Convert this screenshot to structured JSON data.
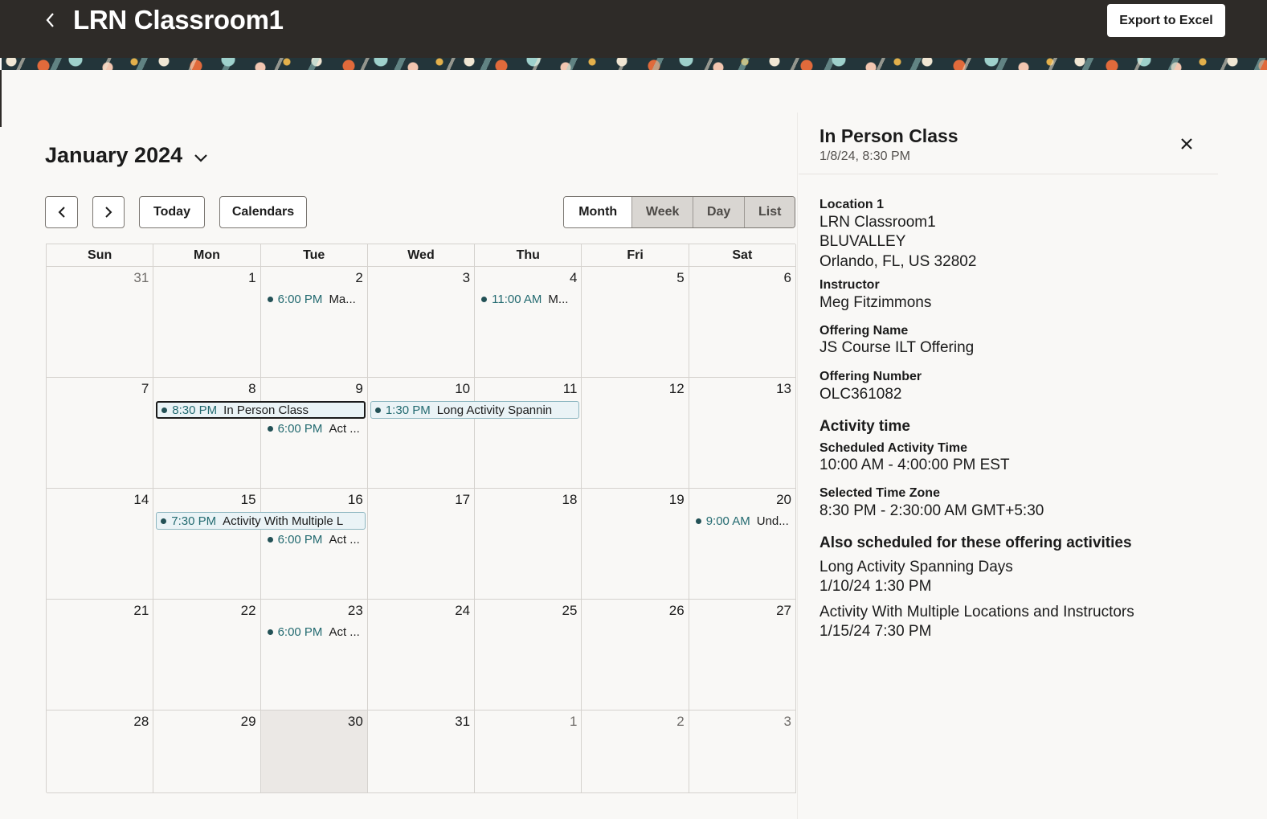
{
  "header": {
    "title": "LRN Classroom1",
    "export_label": "Export to Excel"
  },
  "toolbar": {
    "month_label": "January 2024",
    "today_label": "Today",
    "calendars_label": "Calendars",
    "views": [
      "Month",
      "Week",
      "Day",
      "List"
    ],
    "selected_view": "Month"
  },
  "calendar": {
    "days_of_week": [
      "Sun",
      "Mon",
      "Tue",
      "Wed",
      "Thu",
      "Fri",
      "Sat"
    ],
    "weeks": [
      [
        {
          "d": "31",
          "muted": true
        },
        {
          "d": "1"
        },
        {
          "d": "2"
        },
        {
          "d": "3"
        },
        {
          "d": "4"
        },
        {
          "d": "5"
        },
        {
          "d": "6"
        }
      ],
      [
        {
          "d": "7"
        },
        {
          "d": "8"
        },
        {
          "d": "9"
        },
        {
          "d": "10"
        },
        {
          "d": "11"
        },
        {
          "d": "12"
        },
        {
          "d": "13"
        }
      ],
      [
        {
          "d": "14"
        },
        {
          "d": "15"
        },
        {
          "d": "16"
        },
        {
          "d": "17"
        },
        {
          "d": "18"
        },
        {
          "d": "19"
        },
        {
          "d": "20"
        }
      ],
      [
        {
          "d": "21"
        },
        {
          "d": "22"
        },
        {
          "d": "23"
        },
        {
          "d": "24"
        },
        {
          "d": "25"
        },
        {
          "d": "26"
        },
        {
          "d": "27"
        }
      ],
      [
        {
          "d": "28"
        },
        {
          "d": "29"
        },
        {
          "d": "30",
          "today": true
        },
        {
          "d": "31"
        },
        {
          "d": "1",
          "muted": true
        },
        {
          "d": "2",
          "muted": true
        },
        {
          "d": "3",
          "muted": true
        }
      ]
    ],
    "events": [
      {
        "week": 0,
        "day": 2,
        "span": 1,
        "slot": 0,
        "time": "6:00 PM",
        "title": "Ma...",
        "style": "dot"
      },
      {
        "week": 0,
        "day": 4,
        "span": 1,
        "slot": 0,
        "time": "11:00 AM",
        "title": "M...",
        "style": "dot"
      },
      {
        "week": 1,
        "day": 1,
        "span": 2,
        "slot": 0,
        "time": "8:30 PM",
        "title": "In Person Class",
        "style": "bar",
        "selected": true
      },
      {
        "week": 1,
        "day": 2,
        "span": 1,
        "slot": 1,
        "time": "6:00 PM",
        "title": "Act ...",
        "style": "dot"
      },
      {
        "week": 1,
        "day": 3,
        "span": 2,
        "slot": 0,
        "time": "1:30 PM",
        "title": "Long Activity Spannin",
        "style": "bar"
      },
      {
        "week": 2,
        "day": 1,
        "span": 2,
        "slot": 0,
        "time": "7:30 PM",
        "title": "Activity With Multiple L",
        "style": "bar"
      },
      {
        "week": 2,
        "day": 2,
        "span": 1,
        "slot": 1,
        "time": "6:00 PM",
        "title": "Act ...",
        "style": "dot"
      },
      {
        "week": 2,
        "day": 6,
        "span": 1,
        "slot": 0,
        "time": "9:00 AM",
        "title": "Und...",
        "style": "dot"
      },
      {
        "week": 3,
        "day": 2,
        "span": 1,
        "slot": 0,
        "time": "6:00 PM",
        "title": "Act ...",
        "style": "dot"
      }
    ]
  },
  "detail": {
    "title": "In Person Class",
    "datetime": "1/8/24, 8:30 PM",
    "location_label": "Location 1",
    "location_name": "LRN Classroom1",
    "location_site": "BLUVALLEY",
    "location_address": "Orlando, FL, US 32802",
    "instructor_label": "Instructor",
    "instructor": "Meg Fitzimmons",
    "offering_name_label": "Offering Name",
    "offering_name": "JS Course ILT Offering",
    "offering_number_label": "Offering Number",
    "offering_number": "OLC361082",
    "activity_time_heading": "Activity time",
    "scheduled_label": "Scheduled Activity Time",
    "scheduled_value": "10:00 AM - 4:00:00 PM EST",
    "timezone_label": "Selected Time Zone",
    "timezone_value": "8:30 PM - 2:30:00 AM GMT+5:30",
    "also_heading": "Also scheduled for these offering activities",
    "also": [
      {
        "name": "Long Activity Spanning Days",
        "when": "1/10/24 1:30 PM"
      },
      {
        "name": "Activity With Multiple Locations and Instructors",
        "when": "1/15/24 7:30 PM"
      }
    ]
  },
  "icons": {
    "back": "chevron-left-icon",
    "month_dropdown": "chevron-down-icon",
    "prev": "chevron-left-icon",
    "next": "chevron-right-icon",
    "close": "close-icon"
  }
}
